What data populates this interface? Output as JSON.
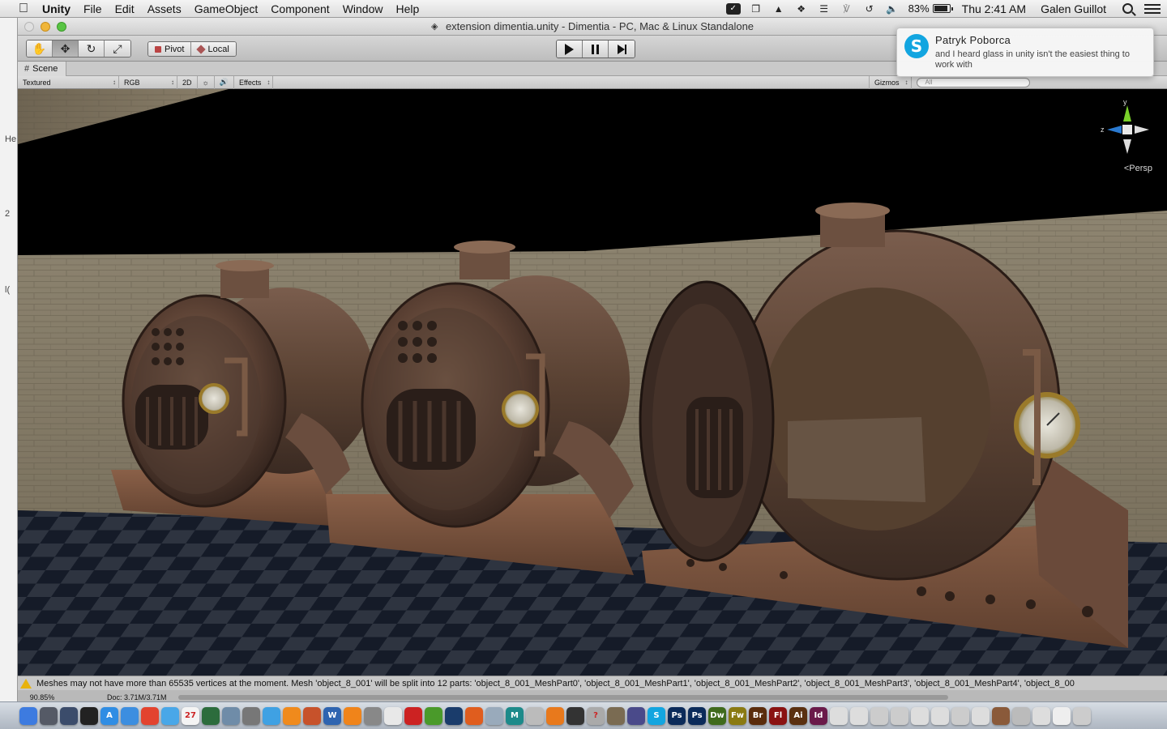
{
  "menubar": {
    "app_name": "Unity",
    "menus": [
      "File",
      "Edit",
      "Assets",
      "GameObject",
      "Component",
      "Window",
      "Help"
    ],
    "battery": "83%",
    "battery_level": 0.83,
    "clock": "Thu 2:41 AM",
    "user": "Galen Guillot"
  },
  "window": {
    "title": "extension dimentia.unity - Dimentia - PC, Mac & Linux Standalone"
  },
  "toolbar": {
    "pivot_label": "Pivot",
    "local_label": "Local"
  },
  "scene": {
    "tab_label": "Scene",
    "draw_mode": "Textured",
    "color_mode": "RGB",
    "mode_2d": "2D",
    "effects": "Effects",
    "gizmos": "Gizmos",
    "search_placeholder": "All",
    "persp_label": "Persp",
    "axis_y": "y",
    "axis_z": "z"
  },
  "status": {
    "message": "Meshes may not have more than 65535 vertices at the moment. Mesh 'object_8_001' will be split into 12 parts: 'object_8_001_MeshPart0', 'object_8_001_MeshPart1', 'object_8_001_MeshPart2', 'object_8_001_MeshPart3', 'object_8_001_MeshPart4', 'object_8_00"
  },
  "infobar": {
    "zoom": "90.85%",
    "doc": "Doc: 3.71M/3.71M"
  },
  "notification": {
    "sender": "Patryk  Poborca",
    "message": "and I heard glass in unity isn't the easiest thing to work with"
  },
  "leftstrip": {
    "fragments": [
      "He",
      "2",
      "l("
    ]
  },
  "dock": {
    "icons": [
      {
        "name": "finder-icon",
        "color": "#3d7be0",
        "label": ""
      },
      {
        "name": "launchpad-icon",
        "color": "#555a66",
        "label": ""
      },
      {
        "name": "mission-control-icon",
        "color": "#3b4c6b",
        "label": ""
      },
      {
        "name": "dashboard-icon",
        "color": "#222",
        "label": ""
      },
      {
        "name": "app-store-icon",
        "color": "#2f8de4",
        "label": "A"
      },
      {
        "name": "safari-icon",
        "color": "#3c8ee0",
        "label": ""
      },
      {
        "name": "chrome-icon",
        "color": "#e3432f",
        "label": ""
      },
      {
        "name": "messages-icon",
        "color": "#49a7e8",
        "label": ""
      },
      {
        "name": "calendar-icon",
        "color": "#f4f4f4",
        "label": "27"
      },
      {
        "name": "facetime-icon",
        "color": "#2c6c3c",
        "label": ""
      },
      {
        "name": "preview-icon",
        "color": "#6f8ca8",
        "label": ""
      },
      {
        "name": "automator-icon",
        "color": "#777",
        "label": ""
      },
      {
        "name": "itunes-icon",
        "color": "#3fa1e3",
        "label": ""
      },
      {
        "name": "ibooks-icon",
        "color": "#f08a1c",
        "label": ""
      },
      {
        "name": "photos-icon",
        "color": "#c7522b",
        "label": ""
      },
      {
        "name": "word-icon",
        "color": "#2e64b0",
        "label": "W"
      },
      {
        "name": "vlc-icon",
        "color": "#f0841a",
        "label": ""
      },
      {
        "name": "system-prefs-icon",
        "color": "#888",
        "label": ""
      },
      {
        "name": "textedit-icon",
        "color": "#e8e8e8",
        "label": ""
      },
      {
        "name": "acrobat-icon",
        "color": "#c22",
        "label": ""
      },
      {
        "name": "utorrent-icon",
        "color": "#4a9a2a",
        "label": ""
      },
      {
        "name": "quicktime-icon",
        "color": "#1a3c6b",
        "label": ""
      },
      {
        "name": "firefox-icon",
        "color": "#e05d1e",
        "label": ""
      },
      {
        "name": "image-icon",
        "color": "#9ab",
        "label": ""
      },
      {
        "name": "maya-icon",
        "color": "#1d8a8a",
        "label": "M"
      },
      {
        "name": "tool-icon",
        "color": "#bbb",
        "label": ""
      },
      {
        "name": "blender-icon",
        "color": "#e8791c",
        "label": ""
      },
      {
        "name": "unity-icon",
        "color": "#333",
        "label": ""
      },
      {
        "name": "help-icon",
        "color": "#aaa",
        "label": "?"
      },
      {
        "name": "gimp-icon",
        "color": "#7a6b52",
        "label": ""
      },
      {
        "name": "monitor-icon",
        "color": "#4a4a8a",
        "label": ""
      },
      {
        "name": "skype-icon",
        "color": "#12a5e0",
        "label": "S"
      },
      {
        "name": "photoshop-icon",
        "color": "#0b2b5a",
        "label": "Ps"
      },
      {
        "name": "photoshop-cc-icon",
        "color": "#0b2b5a",
        "label": "Ps"
      },
      {
        "name": "dreamweaver-icon",
        "color": "#3f6a1c",
        "label": "Dw"
      },
      {
        "name": "fireworks-icon",
        "color": "#8a7a12",
        "label": "Fw"
      },
      {
        "name": "bridge-icon",
        "color": "#5a2c0c",
        "label": "Br"
      },
      {
        "name": "flash-icon",
        "color": "#8a1212",
        "label": "Fl"
      },
      {
        "name": "illustrator-icon",
        "color": "#5a3010",
        "label": "Ai"
      },
      {
        "name": "indesign-icon",
        "color": "#6a1a4a",
        "label": "Id"
      },
      {
        "name": "doc-icon",
        "color": "#ddd",
        "label": ""
      },
      {
        "name": "doc2-icon",
        "color": "#ddd",
        "label": ""
      },
      {
        "name": "doc3-icon",
        "color": "#ccc",
        "label": ""
      },
      {
        "name": "doc4-icon",
        "color": "#ccc",
        "label": ""
      },
      {
        "name": "doc5-icon",
        "color": "#ddd",
        "label": ""
      },
      {
        "name": "doc6-icon",
        "color": "#ddd",
        "label": ""
      },
      {
        "name": "doc7-icon",
        "color": "#ccc",
        "label": ""
      },
      {
        "name": "doc8-icon",
        "color": "#ddd",
        "label": ""
      },
      {
        "name": "photo-thumb-icon",
        "color": "#8a5a3a",
        "label": ""
      },
      {
        "name": "clock-icon",
        "color": "#bbb",
        "label": ""
      },
      {
        "name": "folder-icon",
        "color": "#ddd",
        "label": ""
      },
      {
        "name": "doc9-icon",
        "color": "#eee",
        "label": ""
      },
      {
        "name": "trash-icon",
        "color": "#ccc",
        "label": ""
      }
    ]
  }
}
